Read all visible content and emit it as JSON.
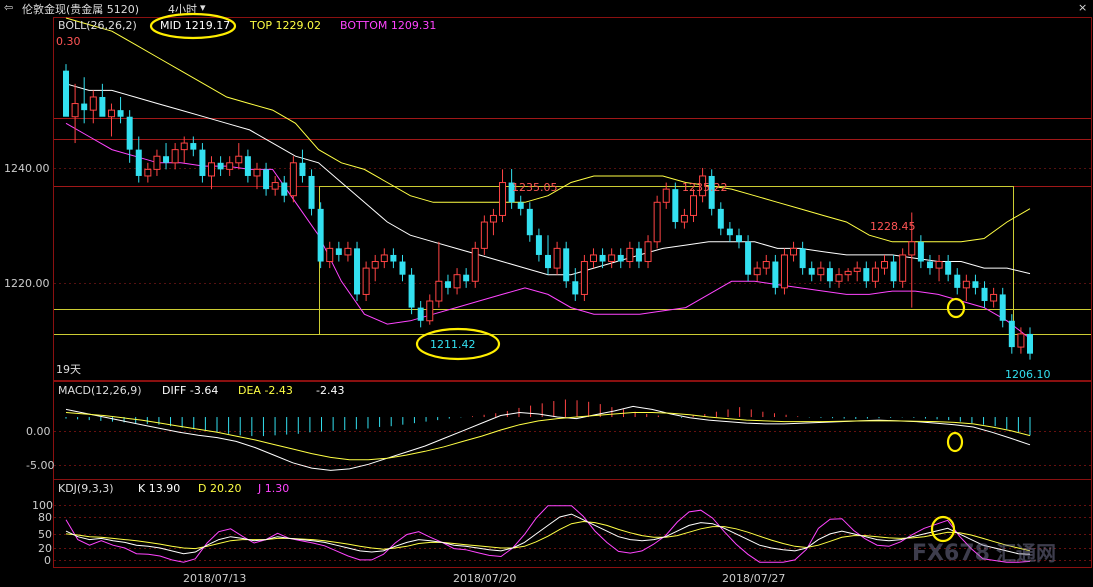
{
  "topbar": {
    "back_icon": "back-arrow-icon",
    "instrument": "伦敦金现(贵金属 5120)",
    "period": "4小时",
    "period_icon": "chevron-down-icon",
    "close_glyph": "×"
  },
  "main_panel": {
    "indicator_name": "BOLL(26,26,2)",
    "mid_label": "MID 1219.17",
    "top_label": "TOP 1229.02",
    "bottom_label": "BOTTOM 1209.31",
    "corner_value": "0.30",
    "span_label": "19天",
    "price_labels": [
      "1235.05",
      "1235.22",
      "1228.45",
      "1211.42",
      "1206.10"
    ],
    "y_ticks": [
      "1240.00",
      "1220.00"
    ]
  },
  "macd_panel": {
    "name": "MACD(12,26,9)",
    "diff_label": "DIFF -3.64",
    "dea_label": "DEA -2.43",
    "macd_value": "-2.43",
    "y_ticks": [
      "0.00",
      "-5.00"
    ]
  },
  "kdj_panel": {
    "name": "KDJ(9,3,3)",
    "k_label": "K 13.90",
    "d_label": "D 20.20",
    "j_label": "J 1.30",
    "y_ticks": [
      "100",
      "80",
      "50",
      "20",
      "0"
    ]
  },
  "x_axis": {
    "dates": [
      "2018/07/13",
      "2018/07/20",
      "2018/07/27"
    ]
  },
  "watermark": {
    "latin": "FX678",
    "cjk": "汇通网"
  },
  "colors": {
    "up": "#ff4444",
    "down": "#33e0f0",
    "boll_mid": "#ffffff",
    "boll_top": "#ffff44",
    "boll_bottom": "#ff44ff",
    "annotation": "#ffee00"
  },
  "chart_data": {
    "type": "candlestick",
    "y_range": [
      1203,
      1258
    ],
    "candles": [
      [
        1250,
        1251,
        1244,
        1243,
        "d"
      ],
      [
        1243,
        1248,
        1239,
        1245,
        "u"
      ],
      [
        1245,
        1249,
        1242,
        1244,
        "d"
      ],
      [
        1244,
        1247,
        1242,
        1246,
        "u"
      ],
      [
        1246,
        1248,
        1244,
        1243,
        "d"
      ],
      [
        1243,
        1245,
        1240,
        1244,
        "u"
      ],
      [
        1244,
        1246,
        1242,
        1243,
        "d"
      ],
      [
        1243,
        1244,
        1236,
        1238,
        "d"
      ],
      [
        1238,
        1240,
        1233,
        1234,
        "d"
      ],
      [
        1234,
        1236,
        1233,
        1235,
        "u"
      ],
      [
        1235,
        1238,
        1234,
        1237,
        "u"
      ],
      [
        1237,
        1239,
        1235,
        1236,
        "d"
      ],
      [
        1236,
        1239,
        1235,
        1238,
        "u"
      ],
      [
        1238,
        1240,
        1236,
        1239,
        "u"
      ],
      [
        1239,
        1240,
        1237,
        1238,
        "d"
      ],
      [
        1238,
        1239,
        1233,
        1234,
        "d"
      ],
      [
        1234,
        1237,
        1232,
        1236,
        "u"
      ],
      [
        1236,
        1237,
        1234,
        1235,
        "d"
      ],
      [
        1235,
        1237,
        1234,
        1236,
        "u"
      ],
      [
        1236,
        1239,
        1235,
        1237,
        "u"
      ],
      [
        1237,
        1238,
        1233,
        1234,
        "d"
      ],
      [
        1234,
        1236,
        1232,
        1235,
        "u"
      ],
      [
        1235,
        1236,
        1231,
        1232,
        "d"
      ],
      [
        1232,
        1234,
        1231,
        1233,
        "u"
      ],
      [
        1233,
        1234,
        1230,
        1231,
        "d"
      ],
      [
        1231,
        1237,
        1230,
        1236,
        "u"
      ],
      [
        1236,
        1238,
        1233,
        1234,
        "d"
      ],
      [
        1234,
        1235,
        1228,
        1229,
        "d"
      ],
      [
        1229,
        1230,
        1220,
        1221,
        "d"
      ],
      [
        1221,
        1224,
        1220,
        1223,
        "u"
      ],
      [
        1223,
        1224,
        1221,
        1222,
        "d"
      ],
      [
        1222,
        1224,
        1221,
        1223,
        "u"
      ],
      [
        1223,
        1224,
        1215,
        1216,
        "d"
      ],
      [
        1216,
        1221,
        1215,
        1220,
        "u"
      ],
      [
        1220,
        1222,
        1218,
        1221,
        "u"
      ],
      [
        1221,
        1223,
        1220,
        1222,
        "u"
      ],
      [
        1222,
        1223,
        1220,
        1221,
        "d"
      ],
      [
        1221,
        1222,
        1218,
        1219,
        "d"
      ],
      [
        1219,
        1220,
        1213,
        1214,
        "d"
      ],
      [
        1214,
        1215,
        1211,
        1212,
        "d"
      ],
      [
        1212,
        1216,
        1211.4,
        1215,
        "u"
      ],
      [
        1215,
        1224,
        1214,
        1218,
        "u"
      ],
      [
        1218,
        1219,
        1216,
        1217,
        "d"
      ],
      [
        1217,
        1220,
        1216,
        1219,
        "u"
      ],
      [
        1219,
        1220,
        1217,
        1218,
        "d"
      ],
      [
        1218,
        1224,
        1217,
        1223,
        "u"
      ],
      [
        1223,
        1228,
        1222,
        1227,
        "u"
      ],
      [
        1227,
        1229,
        1225,
        1228,
        "u"
      ],
      [
        1228,
        1235,
        1227,
        1233,
        "u"
      ],
      [
        1233,
        1235.05,
        1229,
        1230,
        "d"
      ],
      [
        1230,
        1231,
        1228,
        1229,
        "d"
      ],
      [
        1229,
        1230,
        1224,
        1225,
        "d"
      ],
      [
        1225,
        1226,
        1221,
        1222,
        "d"
      ],
      [
        1222,
        1225,
        1219,
        1220,
        "d"
      ],
      [
        1220,
        1224,
        1219,
        1223,
        "u"
      ],
      [
        1223,
        1224,
        1217,
        1218,
        "d"
      ],
      [
        1218,
        1220,
        1215,
        1216,
        "d"
      ],
      [
        1216,
        1222,
        1215,
        1221,
        "u"
      ],
      [
        1221,
        1223,
        1220,
        1222,
        "u"
      ],
      [
        1222,
        1223,
        1220,
        1221,
        "d"
      ],
      [
        1221,
        1223,
        1220,
        1222,
        "u"
      ],
      [
        1222,
        1223,
        1220,
        1221,
        "d"
      ],
      [
        1221,
        1224,
        1220,
        1223,
        "u"
      ],
      [
        1223,
        1224,
        1220,
        1221,
        "d"
      ],
      [
        1221,
        1225,
        1220,
        1224,
        "u"
      ],
      [
        1224,
        1231,
        1223,
        1230,
        "u"
      ],
      [
        1230,
        1233,
        1229,
        1232,
        "u"
      ],
      [
        1232,
        1233,
        1226,
        1227,
        "d"
      ],
      [
        1227,
        1229,
        1226,
        1228,
        "u"
      ],
      [
        1228,
        1232,
        1227,
        1231,
        "u"
      ],
      [
        1231,
        1235.22,
        1230,
        1234,
        "u"
      ],
      [
        1234,
        1235,
        1228,
        1229,
        "d"
      ],
      [
        1229,
        1230,
        1225,
        1226,
        "d"
      ],
      [
        1226,
        1227,
        1224,
        1225,
        "d"
      ],
      [
        1225,
        1226,
        1223,
        1224,
        "d"
      ],
      [
        1224,
        1225,
        1218,
        1219,
        "d"
      ],
      [
        1219,
        1221,
        1218,
        1220,
        "u"
      ],
      [
        1220,
        1222,
        1219,
        1221,
        "u"
      ],
      [
        1221,
        1222,
        1216,
        1217,
        "d"
      ],
      [
        1217,
        1223,
        1216,
        1222,
        "u"
      ],
      [
        1222,
        1224,
        1221,
        1223,
        "u"
      ],
      [
        1223,
        1224,
        1219,
        1220,
        "d"
      ],
      [
        1220,
        1221,
        1218,
        1219,
        "d"
      ],
      [
        1219,
        1221,
        1218,
        1220,
        "u"
      ],
      [
        1220,
        1221,
        1217,
        1218,
        "d"
      ],
      [
        1218,
        1220,
        1217,
        1219,
        "u"
      ],
      [
        1219,
        1220,
        1218,
        1219.5,
        "u"
      ],
      [
        1219.5,
        1221,
        1218,
        1220,
        "u"
      ],
      [
        1220,
        1221,
        1217,
        1218,
        "d"
      ],
      [
        1218,
        1221,
        1217,
        1220,
        "u"
      ],
      [
        1220,
        1222,
        1219,
        1221,
        "u"
      ],
      [
        1221,
        1222,
        1217,
        1218,
        "d"
      ],
      [
        1218,
        1223,
        1217,
        1222,
        "u"
      ],
      [
        1222,
        1228.45,
        1214,
        1224,
        "u"
      ],
      [
        1224,
        1225,
        1220,
        1221,
        "d"
      ],
      [
        1221,
        1222,
        1219,
        1220,
        "d"
      ],
      [
        1220,
        1222,
        1218,
        1221,
        "u"
      ],
      [
        1221,
        1222,
        1218,
        1219,
        "d"
      ],
      [
        1219,
        1220,
        1216,
        1217,
        "d"
      ],
      [
        1217,
        1219,
        1215,
        1218,
        "u"
      ],
      [
        1218,
        1219,
        1216,
        1217,
        "d"
      ],
      [
        1217,
        1218,
        1214,
        1215,
        "d"
      ],
      [
        1215,
        1217,
        1214,
        1216,
        "u"
      ],
      [
        1216,
        1217,
        1211,
        1212,
        "d"
      ],
      [
        1212,
        1213,
        1207,
        1208,
        "d"
      ],
      [
        1208,
        1211,
        1207,
        1210,
        "u"
      ],
      [
        1210,
        1211,
        1206.1,
        1207,
        "d"
      ]
    ],
    "boll_mid": [
      1248,
      1247,
      1247,
      1246,
      1245,
      1244,
      1243,
      1242,
      1241,
      1239,
      1237,
      1236,
      1233,
      1230,
      1227,
      1225,
      1224,
      1223,
      1222,
      1221,
      1220,
      1219,
      1219,
      1220,
      1221,
      1222,
      1223,
      1223.5,
      1224,
      1224,
      1224,
      1223,
      1223,
      1222.5,
      1222,
      1222,
      1222,
      1221.5,
      1221,
      1221,
      1220,
      1220,
      1219.17
    ],
    "boll_top": [
      1258,
      1257,
      1256,
      1254,
      1252,
      1250,
      1248,
      1246,
      1245,
      1244,
      1242,
      1238,
      1236,
      1235,
      1233,
      1231,
      1230,
      1230,
      1230,
      1230,
      1230,
      1231,
      1233,
      1234,
      1234,
      1234,
      1234,
      1233,
      1232.5,
      1232,
      1231,
      1230,
      1229,
      1228,
      1227,
      1225,
      1224,
      1224,
      1224,
      1224,
      1224.5,
      1227,
      1229.02
    ],
    "boll_bottom": [
      1242,
      1240,
      1238,
      1237,
      1236,
      1236,
      1235.5,
      1235.5,
      1235,
      1235,
      1230,
      1225,
      1218,
      1213,
      1211.5,
      1212,
      1213,
      1214,
      1215,
      1216,
      1217,
      1216,
      1214,
      1213,
      1213,
      1213,
      1213.5,
      1214,
      1216,
      1218,
      1218,
      1217.5,
      1217,
      1216.5,
      1216,
      1216,
      1216.5,
      1216.5,
      1216,
      1215,
      1214,
      1212,
      1209.31
    ],
    "macd": {
      "y_range": [
        -8,
        2.5
      ],
      "hist": [
        -0.2,
        -0.3,
        -0.4,
        -0.5,
        -0.6,
        -0.7,
        -0.8,
        -0.9,
        -1.0,
        -1.2,
        -1.4,
        -1.6,
        -1.8,
        -2.0,
        -2.2,
        -2.4,
        -2.5,
        -2.5,
        -2.4,
        -2.3,
        -2.2,
        -2.0,
        -1.9,
        -1.8,
        -1.7,
        -1.6,
        -1.5,
        -1.3,
        -1.2,
        -1.0,
        -0.8,
        -0.6,
        -0.4,
        -0.2,
        -0.05,
        0.1,
        0.3,
        0.5,
        0.8,
        1.2,
        1.5,
        1.8,
        2.1,
        2.3,
        2.2,
        2.0,
        1.7,
        1.3,
        1.0,
        0.7,
        0.4,
        0.2,
        0.0,
        -0.1,
        0.2,
        0.4,
        0.7,
        1.0,
        1.3,
        1.0,
        0.7,
        0.5,
        0.3,
        0.1,
        -0.05,
        -0.1,
        -0.15,
        -0.2,
        -0.25,
        -0.2,
        -0.15,
        -0.1,
        -0.05,
        -0.1,
        -0.2,
        -0.3,
        -0.4,
        -0.6,
        -0.8,
        -1.0,
        -1.2,
        -1.6,
        -2.0,
        -2.4
      ],
      "diff": [
        1.0,
        0.5,
        0.0,
        -0.5,
        -1.0,
        -1.5,
        -2.0,
        -2.4,
        -2.7,
        -3.2,
        -4.0,
        -5.0,
        -6.0,
        -6.7,
        -7.0,
        -6.8,
        -6.2,
        -5.4,
        -4.6,
        -3.8,
        -2.8,
        -1.8,
        -0.8,
        0.2,
        0.6,
        0.4,
        0.0,
        -0.2,
        0.3,
        0.8,
        1.4,
        1.0,
        0.4,
        -0.1,
        -0.4,
        -0.6,
        -0.8,
        -0.9,
        -0.9,
        -0.8,
        -0.7,
        -0.6,
        -0.5,
        -0.4,
        -0.5,
        -0.6,
        -0.8,
        -1.0,
        -1.3,
        -2.0,
        -2.8,
        -3.64
      ],
      "dea": [
        0.6,
        0.4,
        0.2,
        -0.1,
        -0.4,
        -0.8,
        -1.2,
        -1.6,
        -2.0,
        -2.5,
        -3.0,
        -3.6,
        -4.2,
        -4.8,
        -5.3,
        -5.6,
        -5.6,
        -5.4,
        -5.0,
        -4.5,
        -3.9,
        -3.2,
        -2.5,
        -1.7,
        -1.0,
        -0.5,
        -0.2,
        0.0,
        0.2,
        0.4,
        0.6,
        0.6,
        0.5,
        0.3,
        0.0,
        -0.2,
        -0.4,
        -0.5,
        -0.6,
        -0.6,
        -0.6,
        -0.55,
        -0.5,
        -0.5,
        -0.5,
        -0.55,
        -0.6,
        -0.7,
        -0.9,
        -1.3,
        -1.8,
        -2.43
      ]
    },
    "kdj": {
      "y_range": [
        -5,
        110
      ],
      "k": [
        55,
        45,
        40,
        42,
        38,
        35,
        30,
        28,
        25,
        20,
        15,
        18,
        30,
        40,
        45,
        42,
        38,
        40,
        45,
        42,
        40,
        38,
        35,
        30,
        25,
        20,
        18,
        20,
        28,
        35,
        40,
        38,
        35,
        30,
        28,
        25,
        22,
        20,
        25,
        35,
        50,
        65,
        80,
        85,
        75,
        65,
        55,
        45,
        40,
        38,
        40,
        45,
        55,
        65,
        70,
        68,
        60,
        50,
        40,
        30,
        25,
        22,
        20,
        25,
        40,
        50,
        55,
        50,
        45,
        40,
        38,
        40,
        45,
        50,
        55,
        60,
        50,
        40,
        30,
        25,
        20,
        15,
        13.9
      ],
      "d": [
        50,
        48,
        45,
        44,
        42,
        40,
        38,
        35,
        32,
        28,
        25,
        24,
        28,
        33,
        38,
        40,
        40,
        40,
        42,
        42,
        41,
        40,
        38,
        35,
        32,
        28,
        25,
        23,
        25,
        28,
        33,
        35,
        35,
        33,
        31,
        29,
        27,
        25,
        25,
        28,
        36,
        46,
        58,
        68,
        72,
        70,
        65,
        58,
        52,
        47,
        44,
        44,
        47,
        53,
        59,
        63,
        63,
        59,
        53,
        46,
        39,
        33,
        28,
        26,
        30,
        37,
        44,
        47,
        47,
        45,
        43,
        42,
        43,
        45,
        49,
        53,
        52,
        48,
        42,
        36,
        30,
        25,
        20.2
      ],
      "j": [
        75,
        40,
        30,
        38,
        30,
        25,
        15,
        14,
        11,
        4,
        0,
        6,
        34,
        54,
        59,
        46,
        34,
        40,
        51,
        42,
        38,
        34,
        29,
        20,
        11,
        4,
        4,
        14,
        34,
        49,
        54,
        44,
        35,
        24,
        22,
        17,
        12,
        10,
        25,
        49,
        78,
        100,
        100,
        100,
        81,
        55,
        35,
        19,
        16,
        20,
        32,
        47,
        71,
        89,
        92,
        78,
        54,
        32,
        14,
        0,
        0,
        0,
        4,
        23,
        60,
        76,
        77,
        56,
        41,
        30,
        28,
        36,
        49,
        60,
        67,
        74,
        46,
        24,
        6,
        3,
        0,
        0,
        1.3
      ]
    }
  }
}
